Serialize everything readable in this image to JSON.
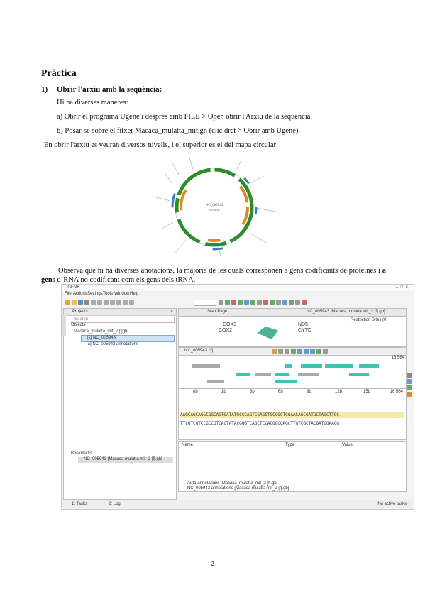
{
  "heading": "Pràctica",
  "step": {
    "number": "1)",
    "title": "Obrir l'arxiu amb la seqüència:"
  },
  "intro": "Hi ha diverses maneres:",
  "option_a": "a) Obrir el programa Ugene i després amb FILE > Open obrir l'Arxiu de la seqüència.",
  "option_b": "b) Posar-se sobre el fitxer Macaca_mulatta_mit.gn (clic dret > Obrir amb Ugene).",
  "levels_text": "En obrir l'arxiu es veuran diversos nivells, i el superior és el del mapa circular:",
  "circular_map": {
    "center_label": "NC_005943",
    "center_sublabel": "16564 bp"
  },
  "observe": {
    "before": "Observa que hi ha diverses anotacions, la majoria de les quals corresponen a gens codificants de proteïnes i ",
    "bold": "a gens",
    "after": " d’RNA no codificant com els gens dels tRNA."
  },
  "ugene": {
    "title": "UGENE",
    "menu": [
      "File",
      "Actions",
      "Settings",
      "Tools",
      "Window",
      "Help"
    ],
    "projects_header": "Projects",
    "search_placeholder": "Search",
    "objects_label": "Objects",
    "tree_file": "Macaca_mulatta_mit_2 [f]gb",
    "tree_seq": "[s] NC_005943",
    "tree_ann": "[a] NC_005943 annotations",
    "bookmarks_label": "Bookmarks",
    "bookmark_item": "NC_005943 [Macaca mulatta mit_2 [f].gb]",
    "seq_tab": "NC_005943 [Macaca mulatta mit_2 [f].gb]",
    "start_page": "Start Page",
    "gene_labels": [
      "COX3",
      "COX2",
      "ND5",
      "CYTD"
    ],
    "restriction_label": "Restriction Sites (0)",
    "seq_panel_title": "NC_005943 [s]",
    "seq_length": "16 564",
    "ruler_ticks": [
      "8b",
      "1b",
      "3b",
      "6b",
      "9b",
      "12b",
      "15b",
      "16 564"
    ],
    "dna_top": "AAGCAGCAGGCGGCAGTGATATGCCCAGTCGAGGTGCCGCTCGAACAGCGATGCTAGCTTGC",
    "dna_bottom": "TTCGTCGTCCGCCGTCACTATACGGGTCAGCTCCACGGCGAGCTTGTCGCTACGATCGAACG",
    "ann_cols": [
      "Name",
      "Type",
      "Value"
    ],
    "ann_rows": [
      "Auto-annotations [Macaca_mulatta_mit_2 [f].gb]",
      "NC_005943 annotations [Macaca mulatta mit_2 [f].gb]"
    ],
    "bottom_tabs": [
      "1: Tasks",
      "2: Log"
    ],
    "status": "No active tasks"
  },
  "page_number": "2"
}
